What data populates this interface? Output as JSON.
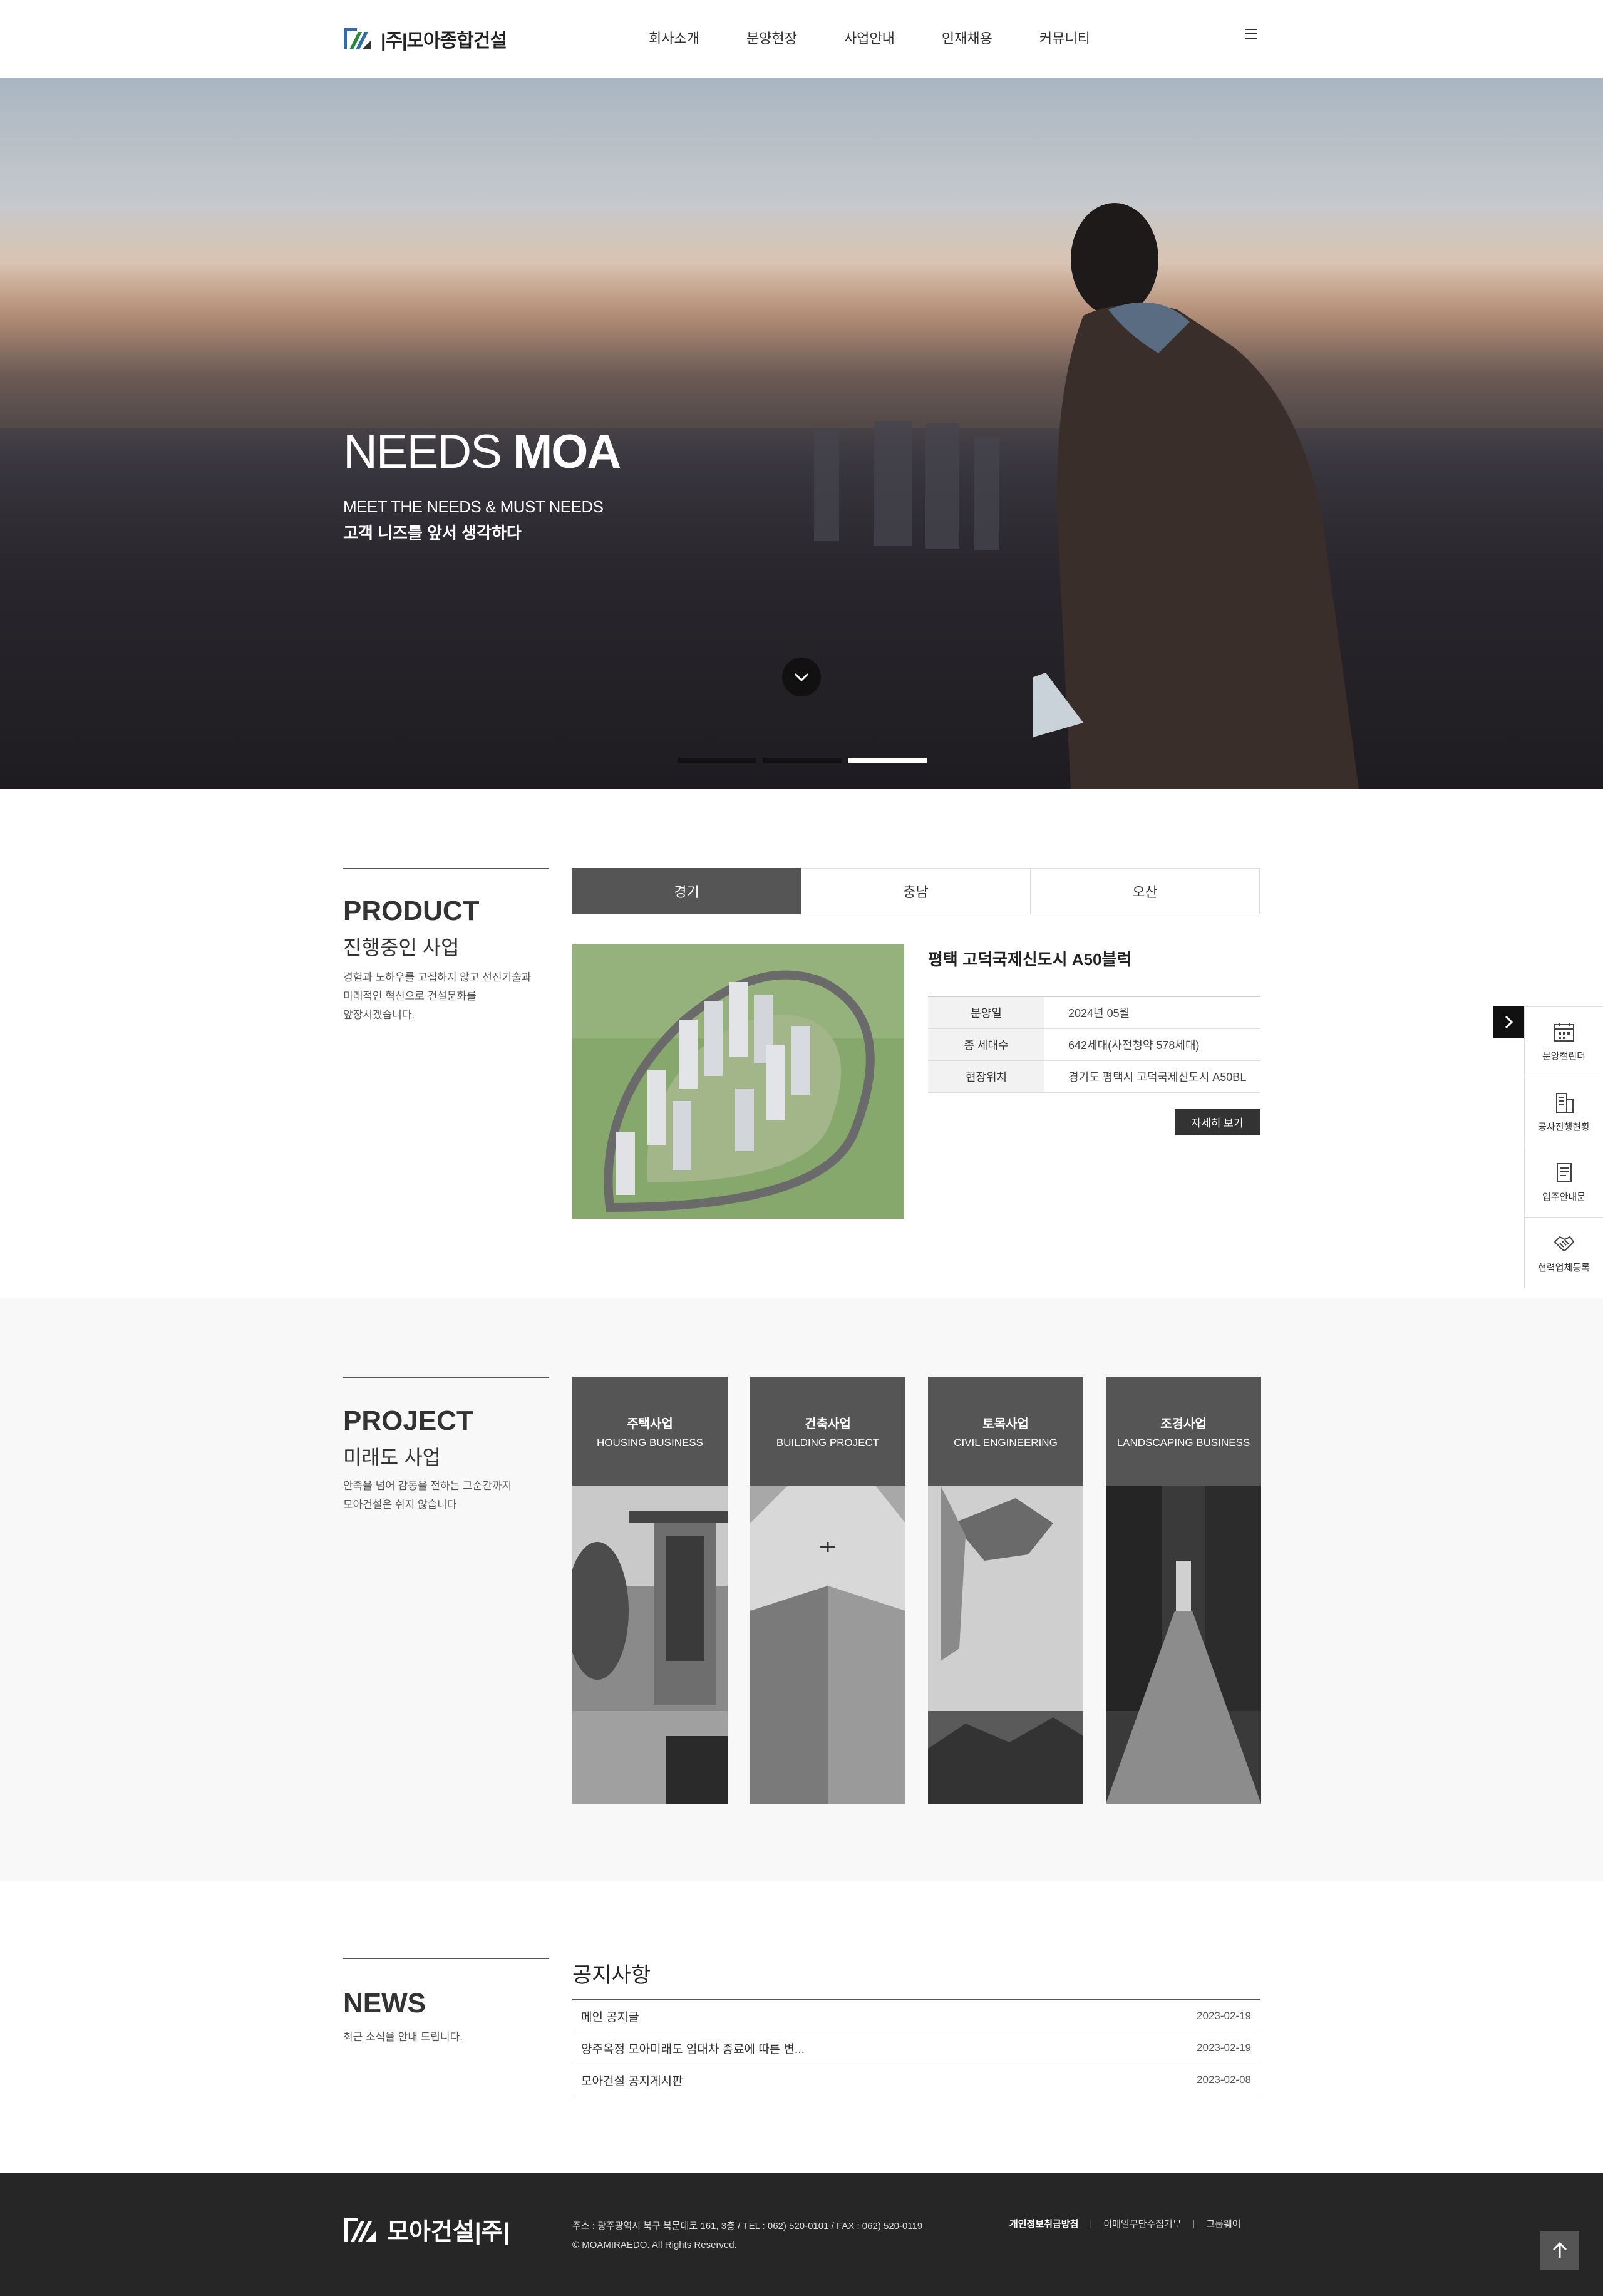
{
  "header": {
    "logo_text": "|주|모아종합건설",
    "nav": [
      "회사소개",
      "분양현장",
      "사업안내",
      "인재채용",
      "커뮤니티"
    ]
  },
  "hero": {
    "title_light": "NEEDS",
    "title_bold": "MOA",
    "sub_en": "MEET THE NEEDS & MUST NEEDS",
    "sub_ko": "고객 니즈를 앞서 생각하다",
    "slide_count": 3,
    "active_slide": 3
  },
  "product": {
    "title": "PRODUCT",
    "subtitle": "진행중인 사업",
    "desc": [
      "경험과 노하우를 고집하지 않고 선진기술과",
      "미래적인 혁신으로 건설문화를",
      "앞장서겠습니다."
    ],
    "tabs": [
      "경기",
      "충남",
      "오산"
    ],
    "active_tab": "경기",
    "name": "평택 고덕국제신도시 A50블럭",
    "rows": [
      {
        "label": "분양일",
        "value": "2024년 05월"
      },
      {
        "label": "총 세대수",
        "value": "642세대(사전청약 578세대)"
      },
      {
        "label": "현장위치",
        "value": "경기도 평택시 고덕국제신도시 A50BL"
      }
    ],
    "more": "자세히 보기"
  },
  "quick_menu": [
    {
      "label": "분양캘린더",
      "icon": "calendar-icon"
    },
    {
      "label": "공사진행현황",
      "icon": "building-icon"
    },
    {
      "label": "입주안내문",
      "icon": "document-icon"
    },
    {
      "label": "협력업체등록",
      "icon": "handshake-icon"
    }
  ],
  "project": {
    "title": "PROJECT",
    "subtitle": "미래도 사업",
    "desc": [
      "안족을 넘어 감동을 전하는 그순간까지",
      "모아건설은 쉬지 않습니다"
    ],
    "cards": [
      {
        "ko": "주택사업",
        "en": "HOUSING BUSINESS"
      },
      {
        "ko": "건축사업",
        "en": "BUILDING PROJECT"
      },
      {
        "ko": "토목사업",
        "en": "CIVIL ENGINEERING"
      },
      {
        "ko": "조경사업",
        "en": "LANDSCAPING BUSINESS"
      }
    ]
  },
  "news": {
    "title": "NEWS",
    "desc": "최근 소식을 안내 드립니다.",
    "board_title": "공지사항",
    "items": [
      {
        "title": "메인 공지글",
        "date": "2023-02-19"
      },
      {
        "title": "양주옥정 모아미래도 임대차 종료에 따른 변...",
        "date": "2023-02-19"
      },
      {
        "title": "모아건설 공지게시판",
        "date": "2023-02-08"
      }
    ]
  },
  "footer": {
    "logo_text": "모아건설|주|",
    "address": "주소 : 광주광역시 북구 북문대로 161, 3층 / TEL : 062) 520-0101 / FAX : 062) 520-0119",
    "copyright": "© MOAMIRAEDO. All Rights Reserved.",
    "links": [
      "개인정보취급방침",
      "이메일무단수집거부",
      "그룹웨어"
    ]
  }
}
